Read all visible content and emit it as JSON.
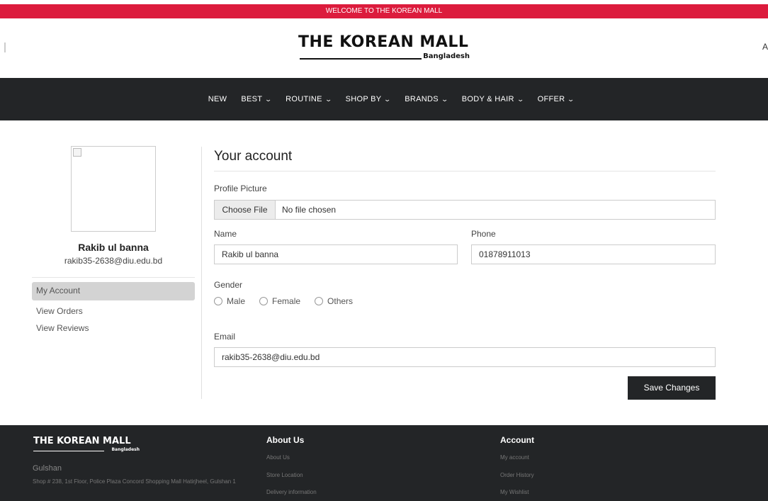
{
  "topbar": {
    "text": "WELCOME TO THE KOREAN MALL"
  },
  "header": {
    "logo_main": "THE KOREAN MALL",
    "logo_sub": "Bangladesh",
    "right_clip": "A"
  },
  "nav": {
    "items": [
      {
        "label": "NEW",
        "dropdown": false
      },
      {
        "label": "BEST",
        "dropdown": true
      },
      {
        "label": "ROUTINE",
        "dropdown": true
      },
      {
        "label": "SHOP BY",
        "dropdown": true
      },
      {
        "label": "BRANDS",
        "dropdown": true
      },
      {
        "label": "BODY & HAIR",
        "dropdown": true
      },
      {
        "label": "OFFER",
        "dropdown": true
      }
    ],
    "chevron": "⌄"
  },
  "sidebar": {
    "name": "Rakib ul banna",
    "email": "rakib35-2638@diu.edu.bd",
    "items": [
      {
        "label": "My Account",
        "active": true
      },
      {
        "label": "View Orders",
        "active": false
      },
      {
        "label": "View Reviews",
        "active": false
      }
    ]
  },
  "form": {
    "title": "Your account",
    "profile_picture_label": "Profile Picture",
    "file_button": "Choose File",
    "file_status": "No file chosen",
    "name_label": "Name",
    "name_value": "Rakib ul banna",
    "phone_label": "Phone",
    "phone_value": "01878911013",
    "gender_label": "Gender",
    "gender_options": [
      "Male",
      "Female",
      "Others"
    ],
    "email_label": "Email",
    "email_value": "rakib35-2638@diu.edu.bd",
    "save_button": "Save Changes"
  },
  "footer": {
    "logo_main": "THE KOREAN MALL",
    "logo_sub": "Bangladesh",
    "city": "Gulshan",
    "address": "Shop # 238, 1st Floor, Police Plaza Concord Shopping Mall Hatirjheel, Gulshan 1",
    "about": {
      "heading": "About Us",
      "links": [
        "About Us",
        "Store Location",
        "Delivery information"
      ]
    },
    "account": {
      "heading": "Account",
      "links": [
        "My account",
        "Order History",
        "My Wishlist"
      ]
    }
  },
  "colors": {
    "topbar": "#dc1c3d",
    "dark": "#232527",
    "active_bg": "#d3d3d3"
  }
}
